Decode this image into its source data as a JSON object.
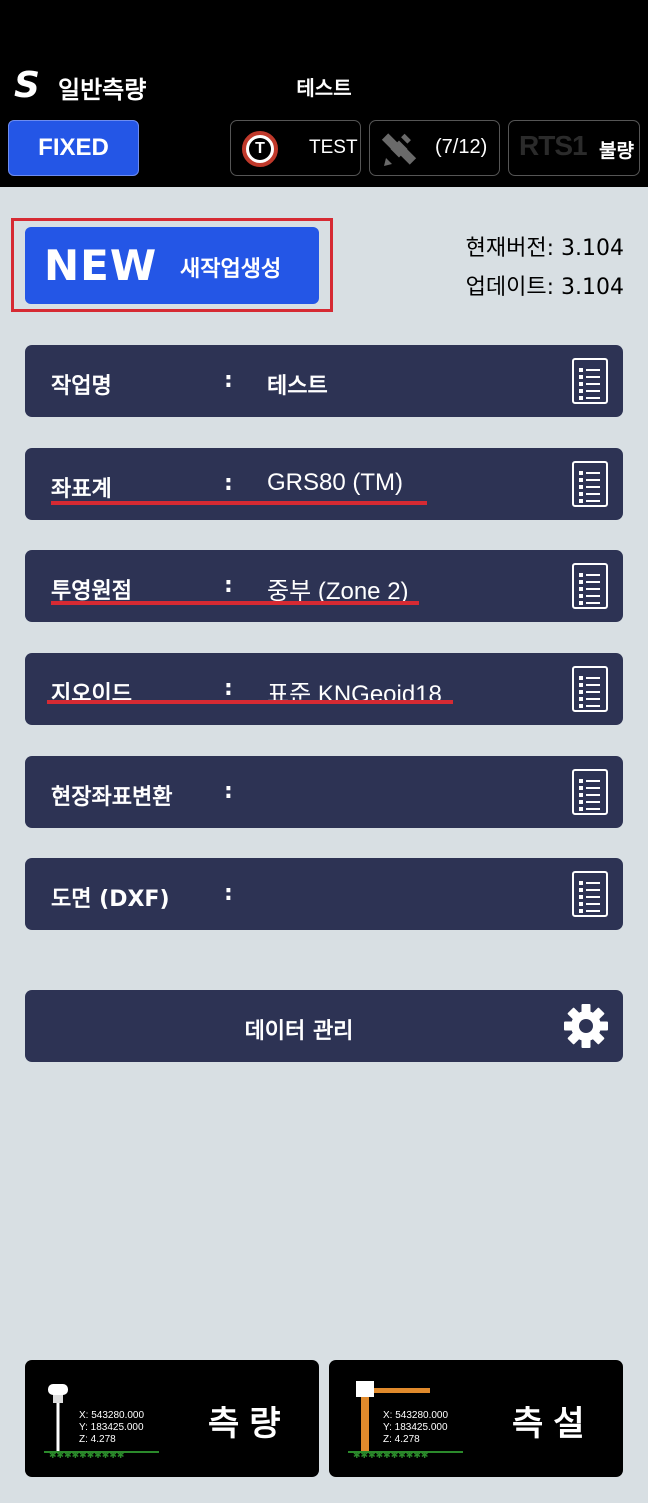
{
  "header": {
    "app_title": "일반측량",
    "project_title": "테스트",
    "logo_letter": "S",
    "fixed_label": "FIXED",
    "status_t_label": "TEST",
    "status_sat_label": "(7/12)",
    "status_rts_label": "RTS1",
    "status_rts_value": "불량"
  },
  "new_job": {
    "word": "NEW",
    "label": "새작업생성"
  },
  "version": {
    "current": "현재버전: 3.104",
    "update": "업데이트: 3.104"
  },
  "rows": [
    {
      "label": "작업명",
      "colon": ":",
      "value": "테스트"
    },
    {
      "label": "좌표계",
      "colon": ":",
      "value": "GRS80 (TM)"
    },
    {
      "label": "투영원점",
      "colon": ":",
      "value": "중부 (Zone 2)"
    },
    {
      "label": "지오이드",
      "colon": ":",
      "value": "표준 KNGeoid18"
    },
    {
      "label": "현장좌표변환",
      "colon": ":",
      "value": ""
    },
    {
      "label": "도면 (DXF)",
      "colon": ":",
      "value": ""
    }
  ],
  "data_management": {
    "label": "데이터 관리"
  },
  "bottom": {
    "measure_label": "측량",
    "stake_label": "측설",
    "coord_x": "X: 543280.000",
    "coord_y": "Y: 183425.000",
    "coord_z": "Z: 4.278"
  },
  "colors": {
    "header_bg": "#000000",
    "accent_blue": "#2456e6",
    "row_bg": "#2d3354",
    "highlight_red": "#d62a33",
    "page_bg": "#d8dfe3"
  },
  "icons": [
    "t-badge-icon",
    "satellite-icon",
    "list-icon",
    "gear-icon",
    "gps-rover-icon",
    "stakeout-icon"
  ]
}
